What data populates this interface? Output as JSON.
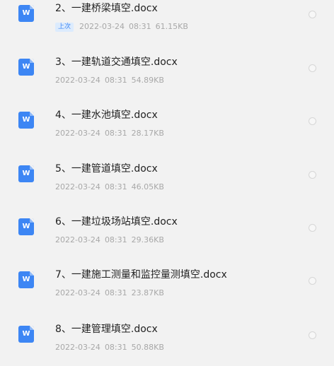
{
  "files": [
    {
      "name": "2、一建桥梁填空.docx",
      "badge": "上次",
      "date": "2022-03-24",
      "time": "08:31",
      "size": "61.15KB",
      "icon": "word-doc-icon",
      "icon_letter": "W"
    },
    {
      "name": "3、一建轨道交通填空.docx",
      "badge": "",
      "date": "2022-03-24",
      "time": "08:31",
      "size": "54.89KB",
      "icon": "word-doc-icon",
      "icon_letter": "W"
    },
    {
      "name": "4、一建水池填空.docx",
      "badge": "",
      "date": "2022-03-24",
      "time": "08:31",
      "size": "28.17KB",
      "icon": "word-doc-icon",
      "icon_letter": "W"
    },
    {
      "name": "5、一建管道填空.docx",
      "badge": "",
      "date": "2022-03-24",
      "time": "08:31",
      "size": "46.05KB",
      "icon": "word-doc-icon",
      "icon_letter": "W"
    },
    {
      "name": "6、一建垃圾场站填空.docx",
      "badge": "",
      "date": "2022-03-24",
      "time": "08:31",
      "size": "29.36KB",
      "icon": "word-doc-icon",
      "icon_letter": "W"
    },
    {
      "name": "7、一建施工测量和监控量测填空.docx",
      "badge": "",
      "date": "2022-03-24",
      "time": "08:31",
      "size": "23.87KB",
      "icon": "word-doc-icon",
      "icon_letter": "W"
    },
    {
      "name": "8、一建管理填空.docx",
      "badge": "",
      "date": "2022-03-24",
      "time": "08:31",
      "size": "50.88KB",
      "icon": "word-doc-icon",
      "icon_letter": "W"
    }
  ],
  "colors": {
    "background": "#f2f2f2",
    "icon_blue": "#3d86f4",
    "title_text": "#222222",
    "meta_text": "#a8a8a8"
  }
}
